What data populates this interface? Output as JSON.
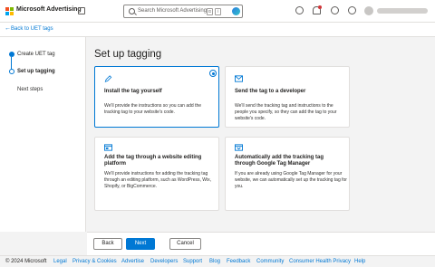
{
  "header": {
    "brand": "Microsoft Advertising",
    "search_placeholder": "Search Microsoft Advertising",
    "shortcut_keys": [
      "G",
      "/"
    ]
  },
  "back_link": "Back to UET tags",
  "stepper": {
    "steps": [
      {
        "label": "Create UET tag",
        "state": "complete"
      },
      {
        "label": "Set up tagging",
        "state": "current"
      },
      {
        "label": "Next steps",
        "state": "upcoming"
      }
    ]
  },
  "main": {
    "title": "Set up tagging",
    "cards": [
      {
        "icon": "pen-icon",
        "title": "Install the tag yourself",
        "description": "We'll provide the instructions so you can add the tracking tag to your website's code.",
        "selected": true
      },
      {
        "icon": "mail-icon",
        "title": "Send the tag to a developer",
        "description": "We'll send the tracking tag and instructions to the people you specify, so they can add the tag to your website's code.",
        "selected": false
      },
      {
        "icon": "website-editor-icon",
        "title": "Add the tag through a website editing platform",
        "description": "We'll provide instructions for adding the tracking tag through an editing platform, such as WordPress, Wix, Shopify, or BigCommerce.",
        "selected": false
      },
      {
        "icon": "tag-manager-icon",
        "title": "Automatically add the tracking tag through Google Tag Manager",
        "description": "If you are already using Google Tag Manager for your website, we can automatically set up the tracking tag for you.",
        "selected": false
      }
    ]
  },
  "buttons": {
    "back": "Back",
    "next": "Next",
    "cancel": "Cancel"
  },
  "footer": {
    "copyright": "© 2024 Microsoft",
    "links": [
      "Legal",
      "Privacy & Cookies",
      "Advertise",
      "Developers",
      "Support",
      "Blog",
      "Feedback",
      "Community",
      "Consumer Health Privacy",
      "Help"
    ]
  },
  "colors": {
    "accent": "#0078d4",
    "logo": [
      "#f25022",
      "#7fba00",
      "#00a4ef",
      "#ffb900"
    ],
    "notification": "#d13438"
  }
}
